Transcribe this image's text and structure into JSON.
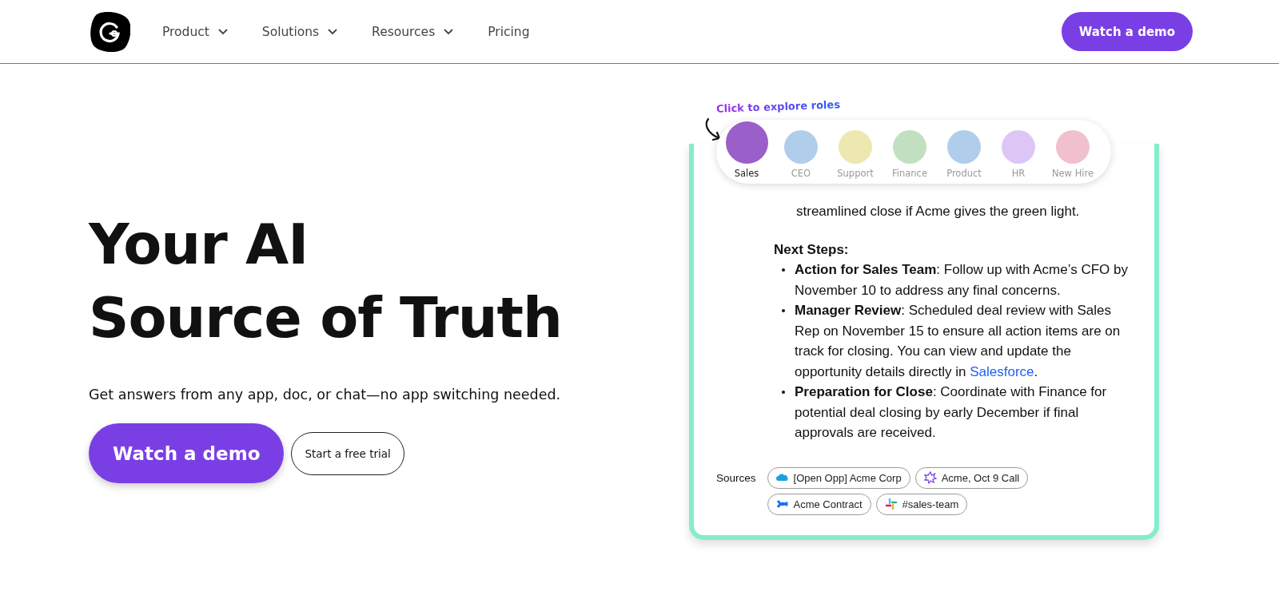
{
  "nav": {
    "items": [
      {
        "label": "Product",
        "dropdown": true
      },
      {
        "label": "Solutions",
        "dropdown": true
      },
      {
        "label": "Resources",
        "dropdown": true
      },
      {
        "label": "Pricing",
        "dropdown": false
      }
    ],
    "cta": "Watch a demo"
  },
  "hero": {
    "title_lines": [
      "Your AI",
      "Source of Truth"
    ],
    "subtitle": "Get answers from any app, doc, or chat—no app switching needed.",
    "primary_button": "Watch a demo",
    "secondary_button": "Start a free trial"
  },
  "roles": {
    "hint": "Click to explore roles",
    "items": [
      {
        "label": "Sales",
        "selected": true,
        "color": "#9b5fc9"
      },
      {
        "label": "CEO",
        "selected": false,
        "color": "#b1cdec"
      },
      {
        "label": "Support",
        "selected": false,
        "color": "#ede8b0"
      },
      {
        "label": "Finance",
        "selected": false,
        "color": "#c2e0c1"
      },
      {
        "label": "Product",
        "selected": false,
        "color": "#b1cdec"
      },
      {
        "label": "HR",
        "selected": false,
        "color": "#ddc6f5"
      },
      {
        "label": "New Hire",
        "selected": false,
        "color": "#f0c1cc"
      }
    ]
  },
  "answer": {
    "lead_text": "streamlined close if Acme gives the green light.",
    "heading": "Next Steps:",
    "bullets": [
      {
        "lead": "Action for Sales Team",
        "text": ": Follow up with Acme’s CFO by November 10 to address any final concerns."
      },
      {
        "lead": "Manager Review",
        "text": ": Scheduled deal review with Sales Rep on November 15 to ensure all action items are on track for closing. You can view and update the opportunity details directly in ",
        "link": "Salesforce",
        "after": "."
      },
      {
        "lead": "Preparation for Close",
        "text": ": Coordinate with Finance for potential deal closing by early December if final approvals are received."
      }
    ],
    "sources_label": "Sources",
    "sources": [
      {
        "label": "[Open Opp] Acme Corp",
        "kind": "cloud"
      },
      {
        "label": "Acme, Oct 9 Call",
        "kind": "burst"
      },
      {
        "label": "Acme Contract",
        "kind": "cross"
      },
      {
        "label": "#sales-team",
        "kind": "grid"
      }
    ]
  }
}
